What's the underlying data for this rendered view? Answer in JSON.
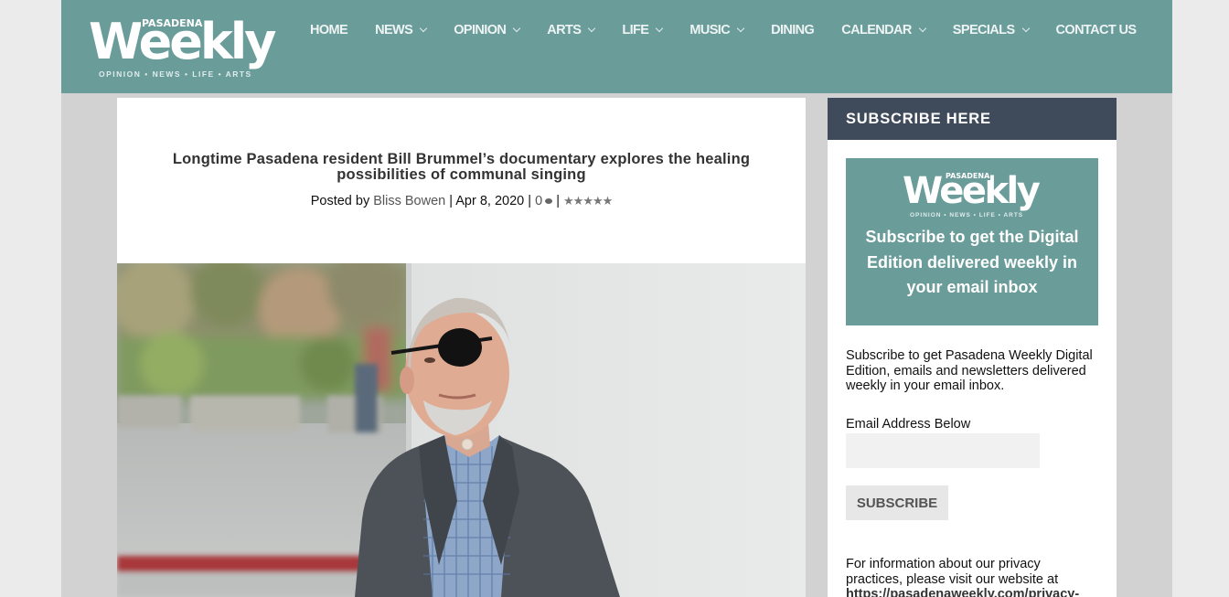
{
  "header": {
    "logo": {
      "small": "PASADENA",
      "big": "Weekly",
      "tagline": "OPINION • NEWS • LIFE • ARTS"
    },
    "nav": [
      {
        "label": "HOME",
        "dropdown": false
      },
      {
        "label": "NEWS",
        "dropdown": true
      },
      {
        "label": "OPINION",
        "dropdown": true
      },
      {
        "label": "ARTS",
        "dropdown": true
      },
      {
        "label": "LIFE",
        "dropdown": true
      },
      {
        "label": "MUSIC",
        "dropdown": true
      },
      {
        "label": "DINING",
        "dropdown": false
      },
      {
        "label": "CALENDAR",
        "dropdown": true
      },
      {
        "label": "SPECIALS",
        "dropdown": true
      },
      {
        "label": "CONTACT US",
        "dropdown": false
      }
    ]
  },
  "article": {
    "title": "Longtime Pasadena resident Bill Brummel’s documentary explores the healing possibilities of communal singing",
    "meta": {
      "posted_by": "Posted by",
      "author": "Bliss Bowen",
      "sep": "|",
      "date": "Apr 8, 2020",
      "comments": "0",
      "rating_stars": "★★★★★"
    }
  },
  "sidebar": {
    "heading": "SUBSCRIBE HERE",
    "promo": {
      "logo_small": "PASADENA",
      "logo_big": "Weekly",
      "logo_tag": "OPINION • NEWS • LIFE • ARTS",
      "text": "Subscribe to get the Digital Edition delivered weekly in your email inbox"
    },
    "description": "Subscribe to get Pasadena Weekly Digital Edition, emails and newsletters delivered weekly in your email inbox.",
    "email_label": "Email Address Below",
    "email_value": "",
    "button": "SUBSCRIBE",
    "privacy_text": "For information about our privacy practices, please visit our website at",
    "privacy_url": "https://pasadenaweekly.com/privacy-"
  },
  "colors": {
    "header_bg": "#6a9c9a",
    "sidebar_head_bg": "#3f4b5b",
    "page_bg": "#d2d2d2"
  }
}
